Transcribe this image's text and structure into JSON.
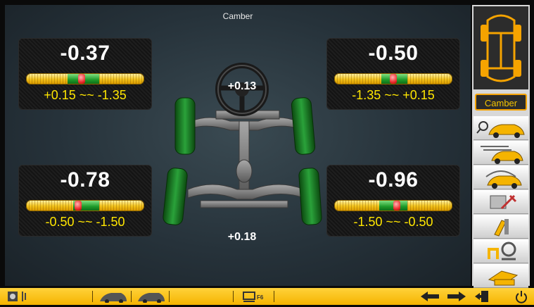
{
  "view": {
    "title": "Camber"
  },
  "wheels": {
    "front_left": {
      "value": "-0.37",
      "range": "+0.15 ~~ -1.35",
      "marker_pos": 0.47,
      "green_start": 0.35,
      "green_end": 0.62
    },
    "front_right": {
      "value": "-0.50",
      "range": "-1.35 ~~ +0.15",
      "marker_pos": 0.5,
      "green_start": 0.4,
      "green_end": 0.62
    },
    "rear_left": {
      "value": "-0.78",
      "range": "-0.50 ~~ -1.50",
      "marker_pos": 0.44,
      "green_start": 0.4,
      "green_end": 0.62
    },
    "rear_right": {
      "value": "-0.96",
      "range": "-1.50 ~~ -0.50",
      "marker_pos": 0.53,
      "green_start": 0.38,
      "green_end": 0.62
    }
  },
  "axles": {
    "front_total": "+0.13",
    "rear_total": "+0.18"
  },
  "sidebar": {
    "mode_label": "Camber",
    "buttons": [
      {
        "icon": "search-car-icon"
      },
      {
        "icon": "car-compensation-icon"
      },
      {
        "icon": "car-runout-icon"
      },
      {
        "icon": "tools-settings-icon"
      },
      {
        "icon": "brake-pedal-icon"
      },
      {
        "icon": "steering-lock-icon"
      },
      {
        "icon": "printer-icon"
      }
    ]
  },
  "bottombar": {
    "f6_label": "F6"
  },
  "colors": {
    "accent": "#f5b400",
    "value_text": "#ffffff",
    "range_text": "#ffe600",
    "green": "#1e9a2a"
  }
}
